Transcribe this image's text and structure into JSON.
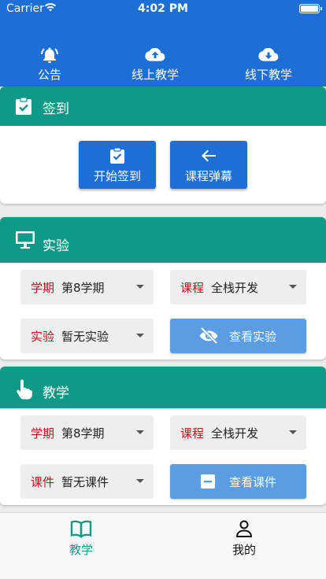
{
  "status": {
    "carrier": "Carrier",
    "time": "4:02 PM"
  },
  "topnav": [
    {
      "label": "公告",
      "icon": "bell-icon"
    },
    {
      "label": "线上教学",
      "icon": "cloud-upload-icon"
    },
    {
      "label": "线下教学",
      "icon": "cloud-download-icon"
    }
  ],
  "checkin": {
    "title": "签到",
    "start_button": "开始签到",
    "danmaku_button": "课程弹幕"
  },
  "experiment": {
    "title": "实验",
    "semester": {
      "label": "学期",
      "value": "第8学期"
    },
    "course": {
      "label": "课程",
      "value": "全栈开发"
    },
    "experiment": {
      "label": "实验",
      "value": "暂无实验"
    },
    "view_button": "查看实验"
  },
  "teaching": {
    "title": "教学",
    "semester": {
      "label": "学期",
      "value": "第8学期"
    },
    "course": {
      "label": "课程",
      "value": "全栈开发"
    },
    "courseware": {
      "label": "课件",
      "value": "暂无课件"
    },
    "view_button": "查看课件"
  },
  "tabbar": {
    "teaching": "教学",
    "mine": "我的"
  },
  "colors": {
    "header_blue": "#1d6fd6",
    "teal": "#0f9a87",
    "label_red": "#c0131d",
    "light_blue_button": "#5a9de3"
  }
}
